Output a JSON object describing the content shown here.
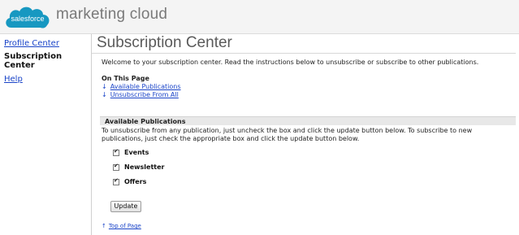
{
  "header": {
    "logo_text": "salesforce",
    "brand": "marketing cloud"
  },
  "sidebar": {
    "items": [
      {
        "label": "Profile Center",
        "link": true
      },
      {
        "label": "Subscription Center",
        "link": false
      },
      {
        "label": "Help",
        "link": true
      }
    ]
  },
  "main": {
    "title": "Subscription Center",
    "welcome": "Welcome to your subscription center. Read the instructions below to unsubscribe or subscribe to other publications.",
    "on_this_page": {
      "heading": "On This Page",
      "links": [
        "Available Publications",
        "Unsubscribe From All"
      ]
    },
    "available": {
      "heading": "Available Publications",
      "instructions": "To unsubscribe from any publication, just uncheck the box and click the update button below. To subscribe to new publications, just check the appropriate box and click the update button below.",
      "publications": [
        {
          "label": "Events",
          "checked": true
        },
        {
          "label": "Newsletter",
          "checked": true
        },
        {
          "label": "Offers",
          "checked": true
        }
      ]
    },
    "update_label": "Update",
    "top_link": "Top of Page"
  },
  "colors": {
    "link": "#1a44c8",
    "logo_blue": "#1798c1"
  }
}
